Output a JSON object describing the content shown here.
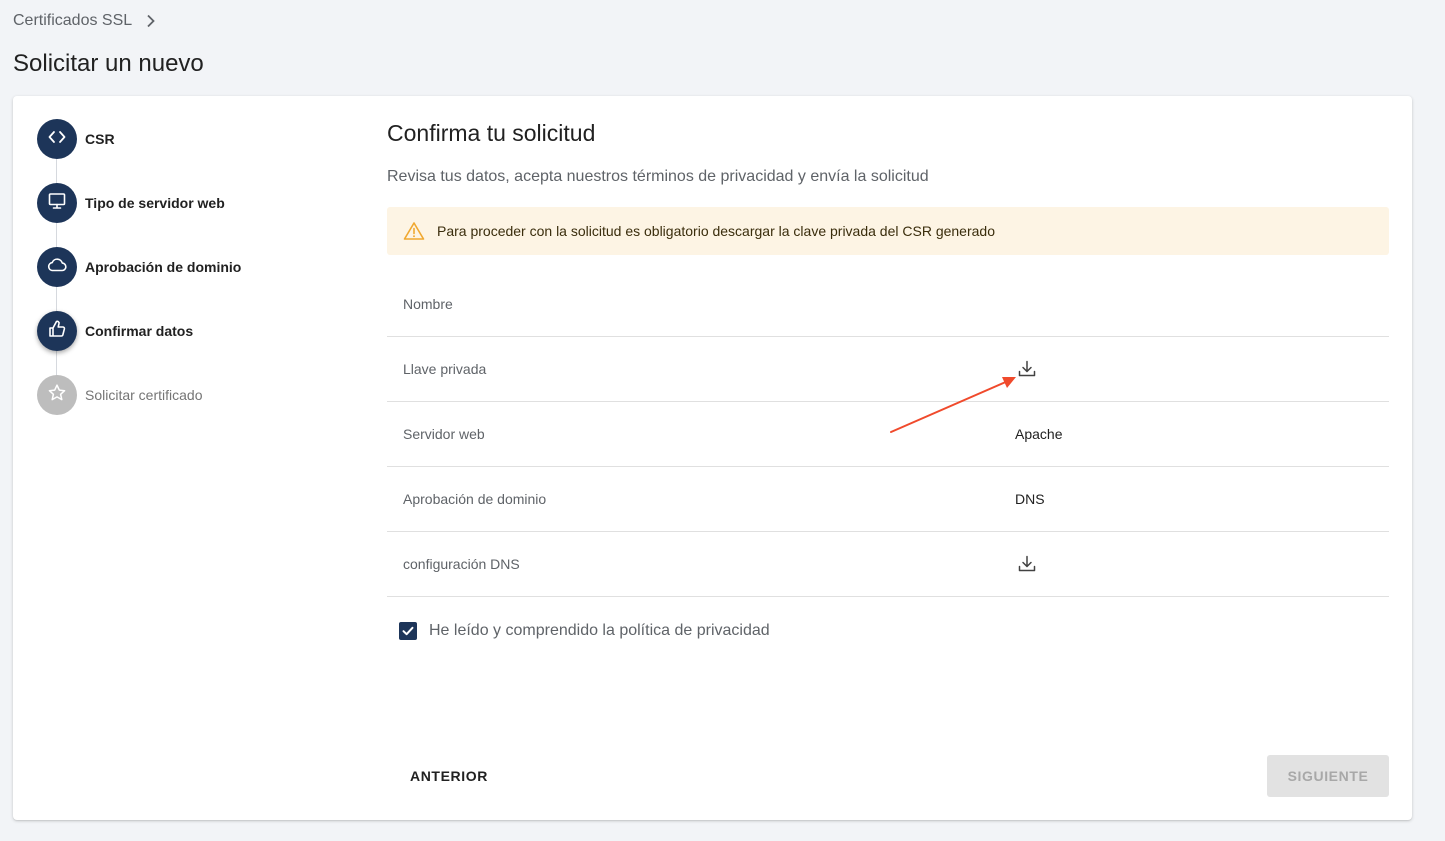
{
  "breadcrumb": {
    "root": "Certificados SSL"
  },
  "page_title": "Solicitar un nuevo",
  "steps": [
    {
      "label": "CSR",
      "icon": "code-icon",
      "state": "completed"
    },
    {
      "label": "Tipo de servidor web",
      "icon": "monitor-icon",
      "state": "completed"
    },
    {
      "label": "Aprobación de dominio",
      "icon": "cloud-icon",
      "state": "completed"
    },
    {
      "label": "Confirmar datos",
      "icon": "thumbs-up-icon",
      "state": "active"
    },
    {
      "label": "Solicitar certificado",
      "icon": "star-icon",
      "state": "disabled"
    }
  ],
  "content": {
    "title": "Confirma tu solicitud",
    "subtitle": "Revisa tus datos, acepta nuestros términos de privacidad y envía la solicitud",
    "alert": "Para proceder con la solicitud es obligatorio descargar la clave privada del CSR generado"
  },
  "rows": [
    {
      "key": "Nombre",
      "value": ""
    },
    {
      "key": "Llave privada",
      "value": "",
      "icon": "download-icon"
    },
    {
      "key": "Servidor web",
      "value": "Apache"
    },
    {
      "key": "Aprobación de dominio",
      "value": "DNS"
    },
    {
      "key": "configuración DNS",
      "value": "",
      "icon": "download-icon"
    }
  ],
  "privacy": {
    "label": "He leído y comprendido la política de privacidad",
    "checked": true
  },
  "buttons": {
    "previous": "ANTERIOR",
    "next": "SIGUIENTE",
    "next_disabled": true
  },
  "colors": {
    "primary": "#1d3559",
    "alert_bg": "#fdf4e4",
    "warning": "#f0a830",
    "annotation_arrow": "#f04a2c",
    "disabled_step": "#bdbdbd"
  }
}
